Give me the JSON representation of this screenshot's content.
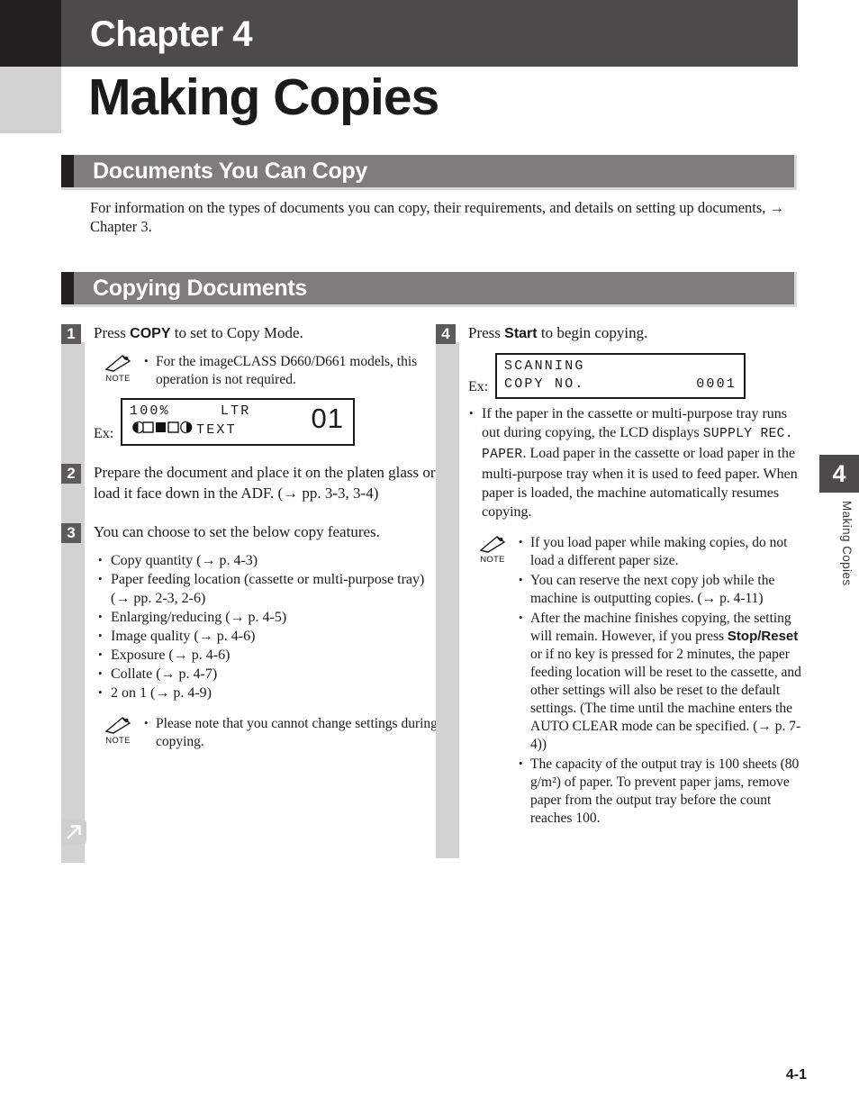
{
  "chapter": {
    "label": "Chapter 4",
    "title": "Making Copies"
  },
  "sections": {
    "documents_you_can_copy": {
      "heading": "Documents You Can Copy",
      "intro": "For information on the types of documents you can copy, their requirements, and details on setting up documents, → Chapter 3."
    },
    "copying_documents": {
      "heading": "Copying Documents"
    }
  },
  "steps": {
    "s1": {
      "number": "1",
      "text_before": "Press ",
      "bold": "COPY",
      "text_after": " to set to Copy Mode.",
      "note_icon_label": "NOTE",
      "note_items": [
        "For the imageCLASS D660/D661 models, this operation is not required."
      ],
      "lcd": {
        "ex_label": "Ex:",
        "line1": "100%     LTR",
        "line2_mode": "TEXT",
        "count": "01",
        "exposure_cells": [
          "half-left",
          "empty",
          "filled",
          "empty",
          "half-right"
        ]
      }
    },
    "s2": {
      "number": "2",
      "text": "Prepare the document and place it on the platen glass or load it face down in the ADF. (→ pp. 3-3, 3-4)"
    },
    "s3": {
      "number": "3",
      "text": "You can choose to set the below copy features.",
      "features": [
        "Copy quantity (→ p. 4-3)",
        "Paper feeding location (cassette or multi-purpose tray) (→ pp. 2-3, 2-6)",
        "Enlarging/reducing (→ p. 4-5)",
        "Image quality (→ p. 4-6)",
        "Exposure (→ p. 4-6)",
        "Collate (→ p. 4-7)",
        "2 on 1 (→ p. 4-9)"
      ],
      "note_icon_label": "NOTE",
      "note_items": [
        "Please note that you cannot change settings during copying."
      ]
    },
    "s4": {
      "number": "4",
      "text_before": "Press ",
      "bold": "Start",
      "text_after": " to begin copying.",
      "lcd": {
        "ex_label": "Ex:",
        "line1": "SCANNING",
        "line2": "COPY NO.",
        "count": "0001"
      },
      "bullet_paper": {
        "part1": "If the paper in the cassette or multi-purpose tray runs out during copying, the LCD displays ",
        "mono1": "SUPPLY REC. PAPER",
        "part2": ". Load paper in the cassette or load paper in the multi-purpose tray when it is used to feed paper. When paper is loaded, the machine automatically resumes copying."
      },
      "note_icon_label": "NOTE",
      "note_items": [
        {
          "text": "If you load paper while making copies, do not load a different paper size."
        },
        {
          "text": "You can reserve the next copy job while the machine is outputting copies. (→ p. 4-11)"
        },
        {
          "part1": "After the machine finishes copying, the setting will remain. However, if you press ",
          "bold": "Stop/Reset",
          "part2": " or if no key is pressed for 2 minutes, the paper feeding location will be reset to the cassette, and other settings will also be reset to the default settings. (The time until the machine enters the AUTO CLEAR mode can be specified. (→ p. 7-4))"
        },
        {
          "text": "The capacity of the output tray is 100 sheets (80 g/m²) of paper. To prevent paper jams, remove paper from the output tray before the count reaches 100."
        }
      ]
    }
  },
  "side_tab": {
    "number": "4",
    "label": "Making Copies"
  },
  "footer": {
    "page_number": "4-1"
  },
  "icons": {
    "continuation": "arrow-up-right-icon",
    "note_pencil": "pencil-note-icon"
  },
  "colors": {
    "band_dark": "#4d4a4b",
    "band_black": "#211f20",
    "band_light_gray": "#d2d2d2",
    "section_gray": "#7e7c7d",
    "rail_gray": "#d2d2d2",
    "badge_gray": "#5c5a5b"
  }
}
